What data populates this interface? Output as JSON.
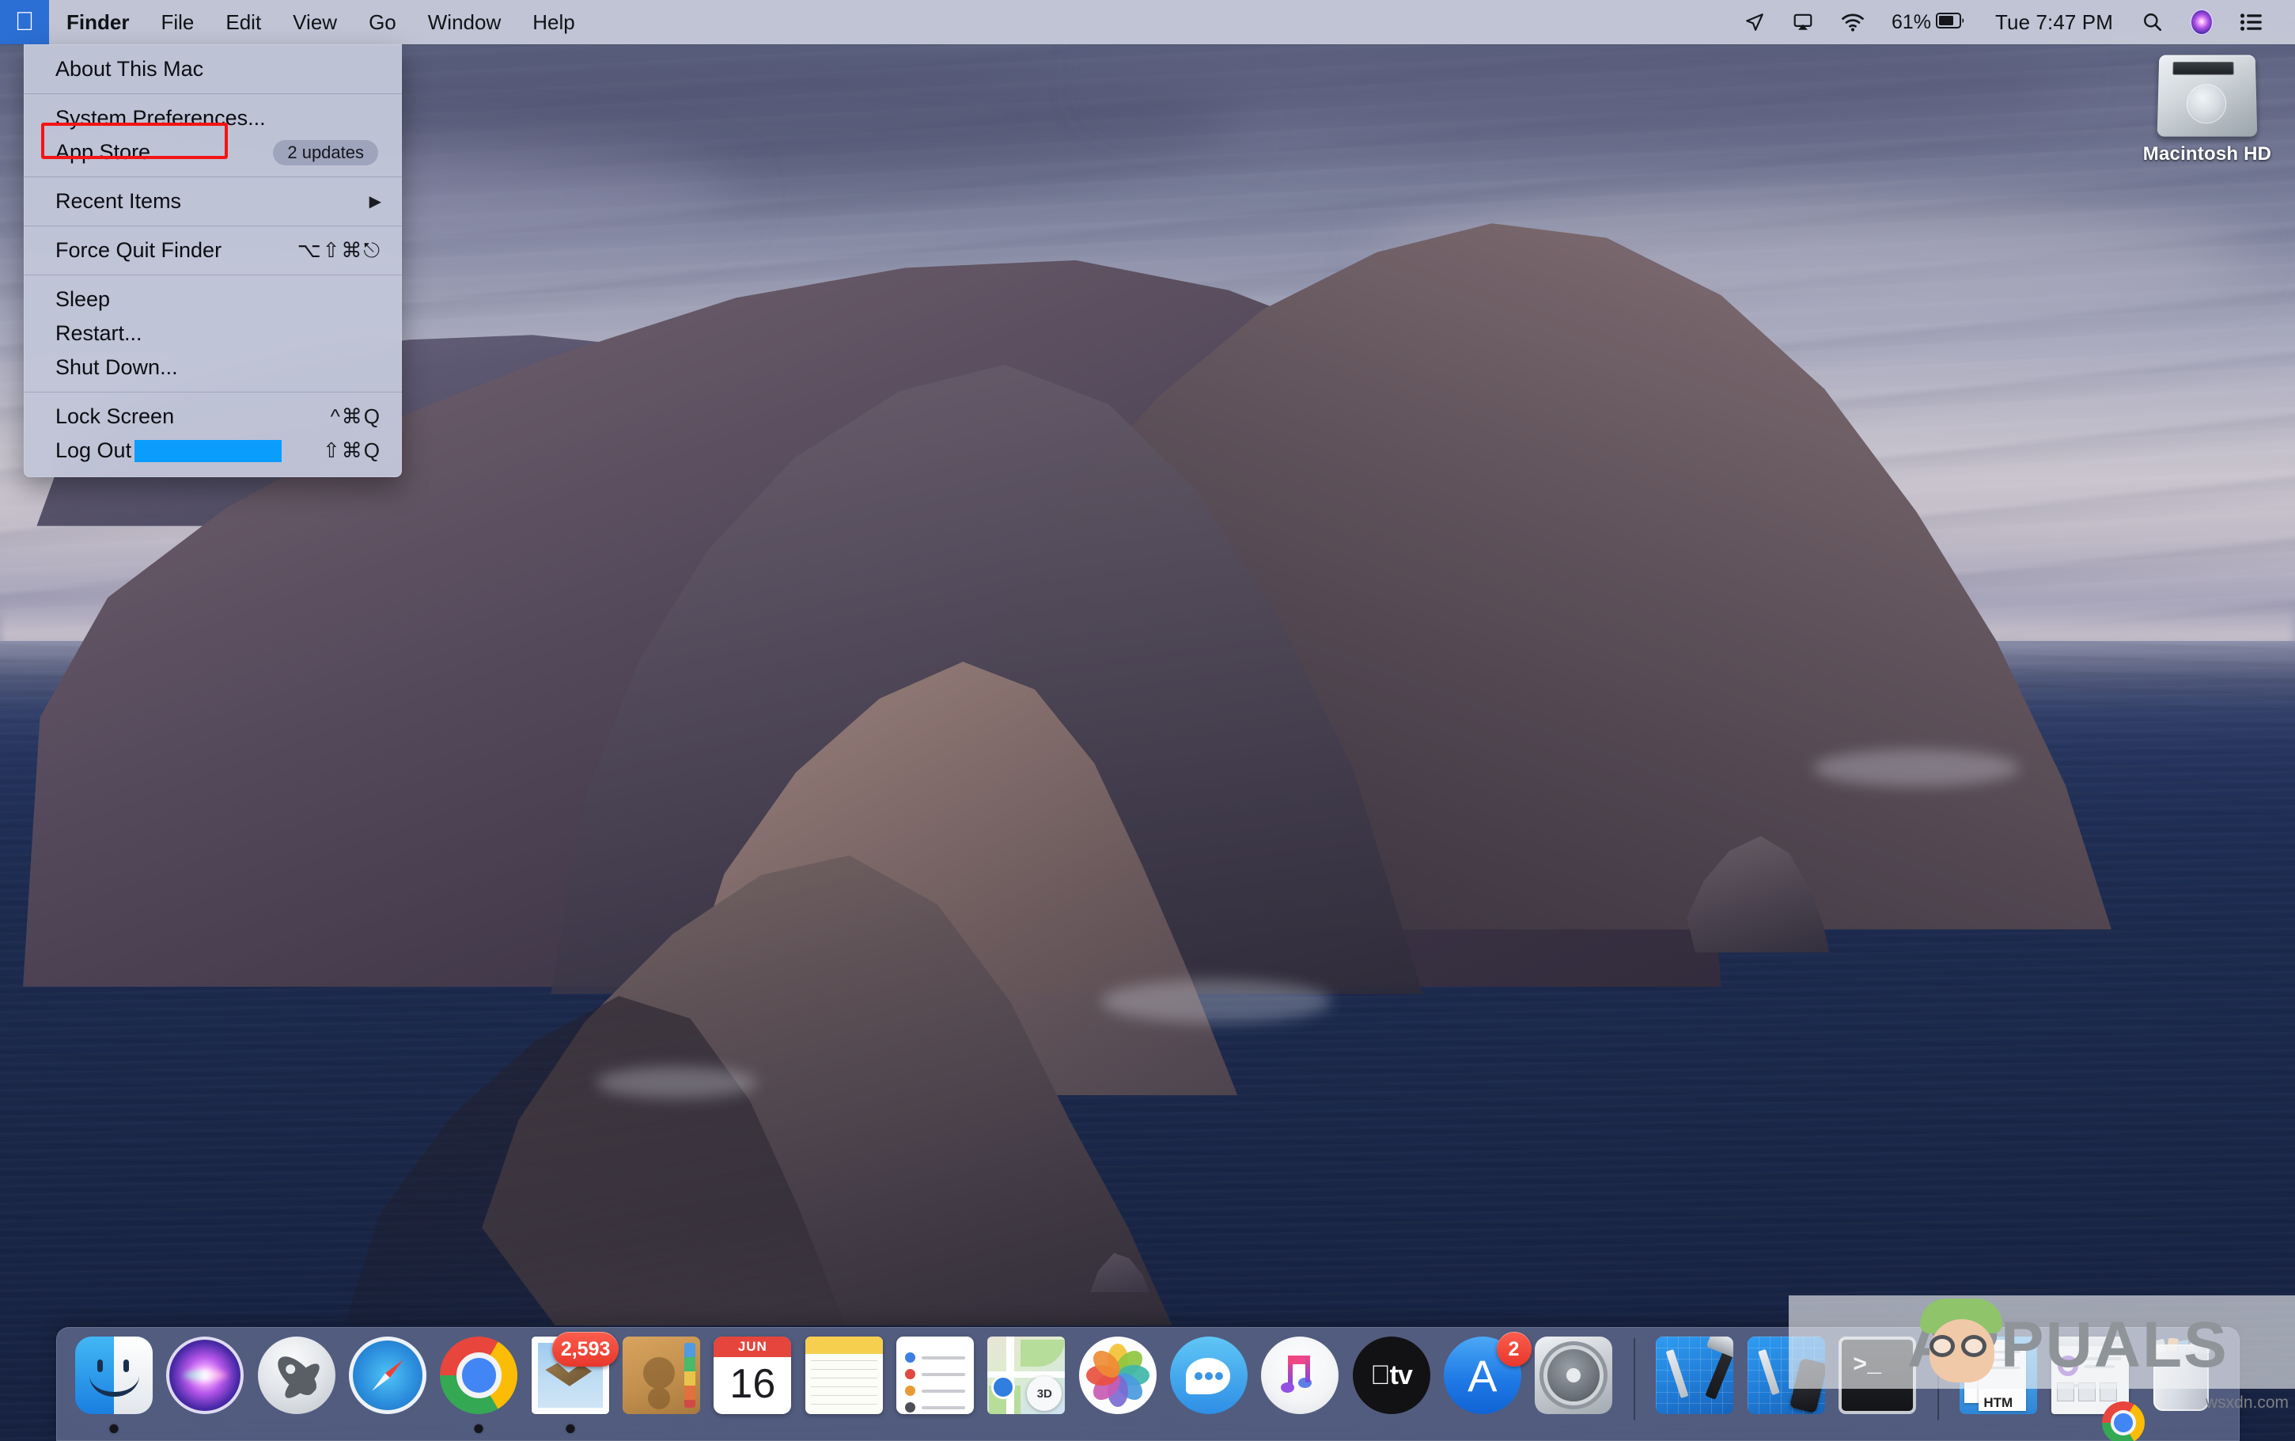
{
  "menubar": {
    "apple_icon": "apple-logo-icon",
    "app_name": "Finder",
    "items": [
      "File",
      "Edit",
      "View",
      "Go",
      "Window",
      "Help"
    ],
    "status": {
      "location_icon": "location-arrow-icon",
      "airplay_icon": "airplay-icon",
      "wifi_icon": "wifi-icon",
      "battery_percent": "61%",
      "battery_icon": "battery-icon",
      "clock": "Tue 7:47 PM",
      "search_icon": "search-icon",
      "siri_icon": "siri-icon",
      "control_center_icon": "notification-center-icon"
    }
  },
  "apple_menu": {
    "items": [
      {
        "label": "About This Mac",
        "shortcut": "",
        "badge": "",
        "arrow": false,
        "highlight": false
      },
      {
        "label": "System Preferences...",
        "shortcut": "",
        "badge": "",
        "arrow": false,
        "highlight": false
      },
      {
        "label": "App Store...",
        "shortcut": "",
        "badge": "2 updates",
        "arrow": false,
        "highlight": true
      },
      {
        "label": "Recent Items",
        "shortcut": "",
        "badge": "",
        "arrow": true,
        "highlight": false
      },
      {
        "label": "Force Quit Finder",
        "shortcut": "⌥⇧⌘⎋",
        "badge": "",
        "arrow": false,
        "highlight": false
      },
      {
        "label": "Sleep",
        "shortcut": "",
        "badge": "",
        "arrow": false,
        "highlight": false
      },
      {
        "label": "Restart...",
        "shortcut": "",
        "badge": "",
        "arrow": false,
        "highlight": false
      },
      {
        "label": "Shut Down...",
        "shortcut": "",
        "badge": "",
        "arrow": false,
        "highlight": false
      },
      {
        "label": "Lock Screen",
        "shortcut": "^⌘Q",
        "badge": "",
        "arrow": false,
        "highlight": false
      },
      {
        "label": "Log Out",
        "shortcut": "⇧⌘Q",
        "badge": "",
        "arrow": false,
        "highlight": false,
        "redacted": true
      }
    ],
    "highlight_color": "#f41414",
    "redaction_color": "#0b9dfc"
  },
  "desktop": {
    "icons": [
      {
        "label": "Macintosh HD",
        "icon": "hard-drive-icon"
      }
    ]
  },
  "dock": {
    "items": [
      {
        "name": "finder",
        "label": "Finder",
        "running": true,
        "badge": ""
      },
      {
        "name": "siri",
        "label": "Siri",
        "running": false,
        "badge": ""
      },
      {
        "name": "launchpad",
        "label": "Launchpad",
        "running": false,
        "badge": ""
      },
      {
        "name": "safari",
        "label": "Safari",
        "running": false,
        "badge": ""
      },
      {
        "name": "chrome",
        "label": "Google Chrome",
        "running": true,
        "badge": ""
      },
      {
        "name": "mail",
        "label": "Mail",
        "running": true,
        "badge": "2,593"
      },
      {
        "name": "contacts",
        "label": "Contacts",
        "running": false,
        "badge": ""
      },
      {
        "name": "calendar",
        "label": "Calendar",
        "running": false,
        "badge": "",
        "month": "JUN",
        "day": "16"
      },
      {
        "name": "notes",
        "label": "Notes",
        "running": false,
        "badge": ""
      },
      {
        "name": "reminders",
        "label": "Reminders",
        "running": false,
        "badge": ""
      },
      {
        "name": "maps",
        "label": "Maps",
        "running": false,
        "badge": "",
        "compass_label": "3D"
      },
      {
        "name": "photos",
        "label": "Photos",
        "running": false,
        "badge": ""
      },
      {
        "name": "messages",
        "label": "Messages",
        "running": false,
        "badge": ""
      },
      {
        "name": "music",
        "label": "Music",
        "running": false,
        "badge": ""
      },
      {
        "name": "tv",
        "label": "TV",
        "running": false,
        "badge": "",
        "glyph": "tv"
      },
      {
        "name": "appstore",
        "label": "App Store",
        "running": false,
        "badge": "2"
      },
      {
        "name": "system-preferences",
        "label": "System Preferences",
        "running": false,
        "badge": ""
      },
      {
        "name": "xcode",
        "label": "Xcode",
        "running": false,
        "badge": ""
      },
      {
        "name": "simulator",
        "label": "Simulator",
        "running": false,
        "badge": ""
      },
      {
        "name": "terminal",
        "label": "Terminal",
        "running": false,
        "badge": "",
        "prompt": ">_"
      },
      {
        "name": "documents-stack",
        "label": "Documents",
        "running": false,
        "badge": "",
        "filetype": "HTM"
      },
      {
        "name": "window-thumbnail",
        "label": "Minimized Window",
        "running": false,
        "badge": ""
      },
      {
        "name": "trash",
        "label": "Trash",
        "running": false,
        "badge": ""
      }
    ]
  },
  "watermark": {
    "text": "APPUALS",
    "source": "wsxdn.com"
  }
}
